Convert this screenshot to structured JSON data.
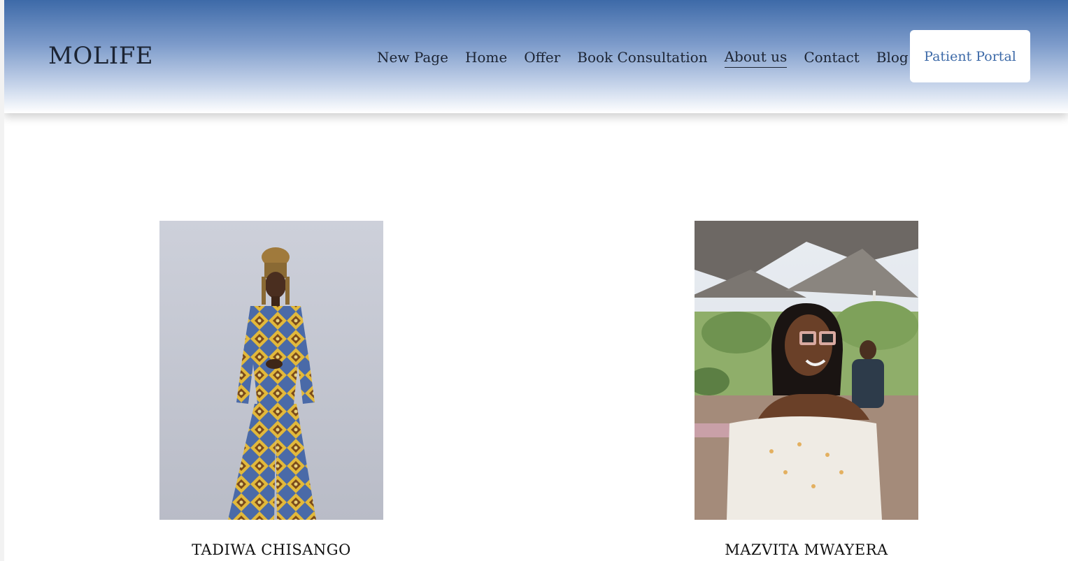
{
  "header": {
    "logo": "MOLIFE",
    "nav": [
      {
        "label": "New Page",
        "active": false
      },
      {
        "label": "Home",
        "active": false
      },
      {
        "label": "Offer",
        "active": false
      },
      {
        "label": "Book Consultation",
        "active": false
      },
      {
        "label": "About us",
        "active": true
      },
      {
        "label": "Contact",
        "active": false
      },
      {
        "label": "Blog",
        "active": false
      }
    ],
    "portal_button": "Patient Portal"
  },
  "colors": {
    "header_top": "#3d6aa8",
    "header_bottom": "#ffffff",
    "text": "#1c2433",
    "accent": "#3d6aa8"
  },
  "team": [
    {
      "name": "TADIWA CHISANGO",
      "photo": "woman-in-patterned-suit-photo"
    },
    {
      "name": "MAZVITA MWAYERA",
      "photo": "woman-with-sunglasses-outdoor-cafe-photo"
    }
  ]
}
